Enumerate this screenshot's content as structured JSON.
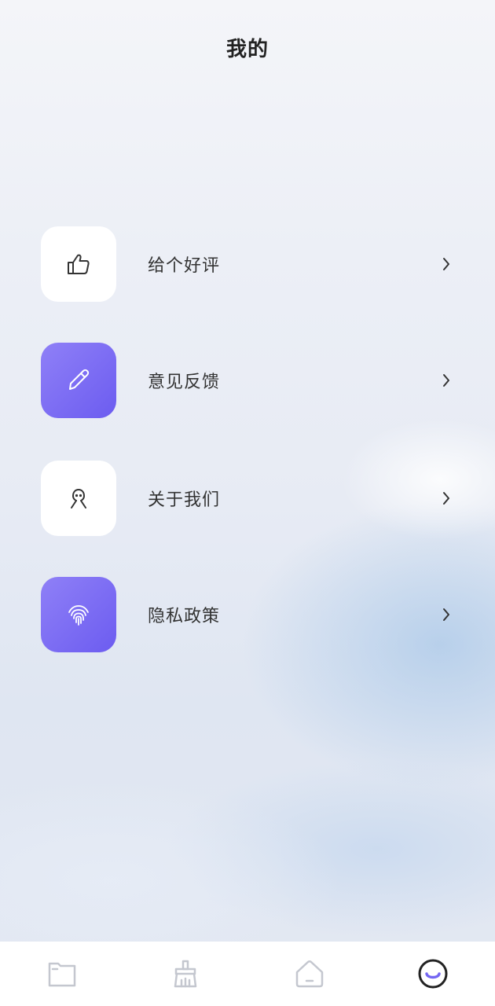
{
  "header": {
    "title": "我的"
  },
  "menu": [
    {
      "label": "给个好评",
      "icon": "thumbs-up-icon"
    },
    {
      "label": "意见反馈",
      "icon": "pencil-icon"
    },
    {
      "label": "关于我们",
      "icon": "person-icon"
    },
    {
      "label": "隐私政策",
      "icon": "fingerprint-icon"
    }
  ],
  "tabbar": [
    {
      "icon": "folder-icon",
      "active": false
    },
    {
      "icon": "broom-icon",
      "active": false
    },
    {
      "icon": "home-icon",
      "active": false
    },
    {
      "icon": "smiley-icon",
      "active": true
    }
  ],
  "colors": {
    "accent": "#7466f2",
    "tab_inactive": "#c4c7cf",
    "tab_active": "#222222"
  }
}
